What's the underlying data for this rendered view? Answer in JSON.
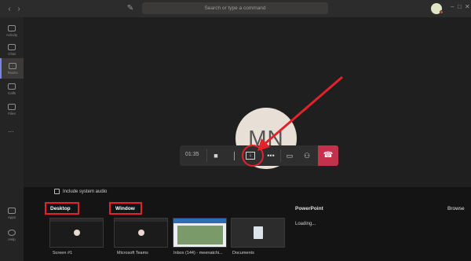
{
  "titlebar": {
    "back_icon": "chevron-left-icon",
    "forward_icon": "chevron-right-icon",
    "compose_icon": "compose-icon",
    "search_placeholder": "Search or type a command"
  },
  "rail": {
    "items": [
      {
        "label": "Activity",
        "icon": "bell-icon"
      },
      {
        "label": "Chat",
        "icon": "chat-icon"
      },
      {
        "label": "Teams",
        "icon": "teams-icon"
      },
      {
        "label": "Calls",
        "icon": "phone-icon"
      },
      {
        "label": "Files",
        "icon": "files-icon"
      }
    ],
    "more_label": "...",
    "bottom": [
      {
        "label": "Apps",
        "icon": "apps-icon"
      },
      {
        "label": "Help",
        "icon": "help-icon"
      }
    ]
  },
  "call": {
    "participant_initials": "MN",
    "timer": "01:35",
    "buttons": [
      "camera-icon",
      "mic-icon",
      "share-screen-icon",
      "more-options-icon",
      "chat-icon",
      "participants-icon",
      "hangup-icon"
    ]
  },
  "share": {
    "system_audio_label": "Include system audio",
    "desktop_label": "Desktop",
    "window_label": "Window",
    "powerpoint_label": "PowerPoint",
    "browse_label": "Browse",
    "loading_label": "Loading...",
    "thumbnails": [
      {
        "caption": "Screen #1"
      },
      {
        "caption": "Microsoft Teams"
      },
      {
        "caption": "Inbox (144) - meenatchi..."
      },
      {
        "caption": "Documents"
      }
    ]
  },
  "colors": {
    "accent": "#7b83eb",
    "hangup": "#c4314b",
    "annotation": "#e3222b"
  }
}
